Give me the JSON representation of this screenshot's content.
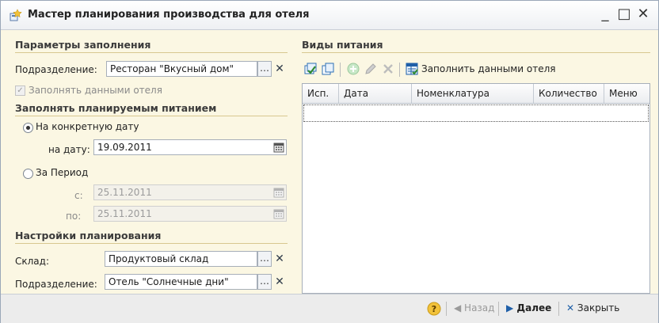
{
  "window": {
    "title": "Мастер планирования производства для отеля",
    "minimize": "_",
    "maximize": "□",
    "close": "✕"
  },
  "fill_params": {
    "title": "Параметры заполнения",
    "division_label": "Подразделение:",
    "division_value": "Ресторан \"Вкусный дом\"",
    "fill_hotel_label": "Заполнять данными отеля",
    "fill_hotel_checked": true
  },
  "planned_meals": {
    "title": "Заполнять планируемым питанием",
    "on_date_label": "На конкретную дату",
    "on_date_selected": true,
    "date_label": "на дату:",
    "date_value": "19.09.2011",
    "period_label": "За Период",
    "from_label": "с:",
    "from_value": "25.11.2011",
    "to_label": "по:",
    "to_value": "25.11.2011"
  },
  "plan_settings": {
    "title": "Настройки планирования",
    "warehouse_label": "Склад:",
    "warehouse_value": "Продуктовый склад",
    "division_label": "Подразделение:",
    "division_value": "Отель \"Солнечные дни\""
  },
  "meal_types": {
    "title": "Виды питания",
    "fill_hotel_button": "Заполнить данными отеля",
    "columns": [
      "Исп.",
      "Дата",
      "Номенклатура",
      "Количество",
      "Меню"
    ]
  },
  "footer": {
    "help": "?",
    "back": "Назад",
    "next": "Далее",
    "close": "Закрыть"
  },
  "colors": {
    "window_bg": "#fbf7e3",
    "accent_green": "#2f8a2f",
    "accent_blue": "#1f5fa8"
  }
}
